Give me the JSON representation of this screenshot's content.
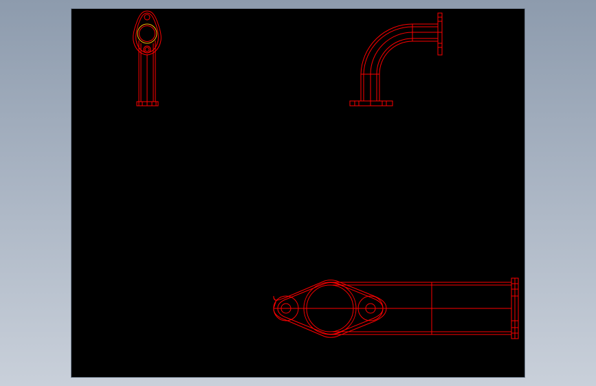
{
  "viewport": {
    "background_color": "#000000"
  },
  "drawing": {
    "line_color": "#ff0000",
    "accent_color": "#ffb000",
    "views": [
      {
        "name": "side-view"
      },
      {
        "name": "elbow-view"
      },
      {
        "name": "top-view"
      }
    ]
  }
}
